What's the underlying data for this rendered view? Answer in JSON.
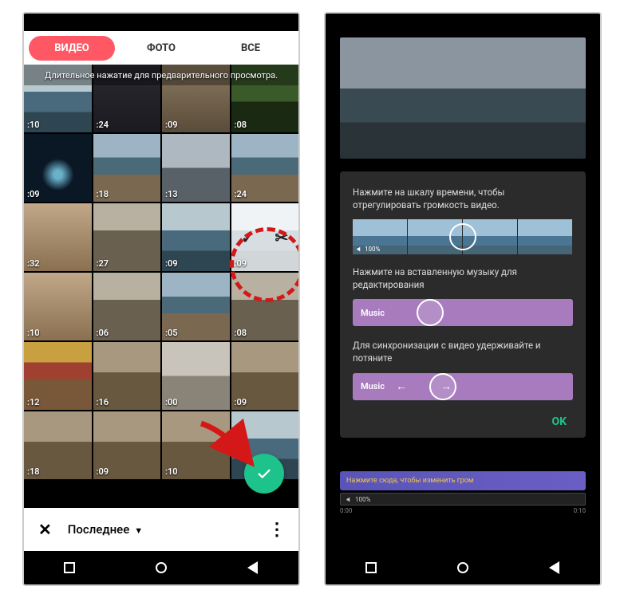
{
  "left": {
    "tabs": {
      "video": "ВИДЕО",
      "photo": "ФОТО",
      "all": "ВСЕ"
    },
    "hint": "Длительное нажатие для предварительного просмотра.",
    "thumbs": [
      {
        "d": ":10",
        "t": "sea"
      },
      {
        "d": ":24",
        "t": "dark"
      },
      {
        "d": ":09",
        "t": "room"
      },
      {
        "d": ":08",
        "t": "tree"
      },
      {
        "d": ":09",
        "t": "night"
      },
      {
        "d": ":18",
        "t": "coast"
      },
      {
        "d": ":13",
        "t": "boats"
      },
      {
        "d": ":24",
        "t": "coast"
      },
      {
        "d": ":32",
        "t": "light"
      },
      {
        "d": ":27",
        "t": "street"
      },
      {
        "d": ":09",
        "t": "sea"
      },
      {
        "d": ":09",
        "t": "sea",
        "sel": true
      },
      {
        "d": ":10",
        "t": "light"
      },
      {
        "d": ":06",
        "t": "street"
      },
      {
        "d": ":05",
        "t": "coast"
      },
      {
        "d": ":08",
        "t": "street"
      },
      {
        "d": ":12",
        "t": "flag"
      },
      {
        "d": ":16",
        "t": "crowd"
      },
      {
        "d": ":00",
        "t": "build"
      },
      {
        "d": ":09",
        "t": "crowd"
      },
      {
        "d": ":18",
        "t": "crowd"
      },
      {
        "d": ":09",
        "t": "crowd"
      },
      {
        "d": ":10",
        "t": "crowd"
      },
      {
        "d": "",
        "t": "sea"
      }
    ],
    "overlay": {
      "check": "✓",
      "scissors": "✂"
    },
    "sheet": {
      "label": "Последнее"
    }
  },
  "right": {
    "dlg": {
      "t1": "Нажмите на шкалу времени, чтобы отрегулировать громкость видео.",
      "vol": "100%",
      "t2": "Нажмите на вставленную музыку для редактирования",
      "music": "Music",
      "t3": "Для синхронизации с видео удерживайте и потяните",
      "ok": "OK"
    },
    "tl": {
      "hint": "Нажмите сюда, чтобы изменить гром",
      "vol": "100%",
      "t0": "0:00",
      "t1": "0:10"
    }
  }
}
